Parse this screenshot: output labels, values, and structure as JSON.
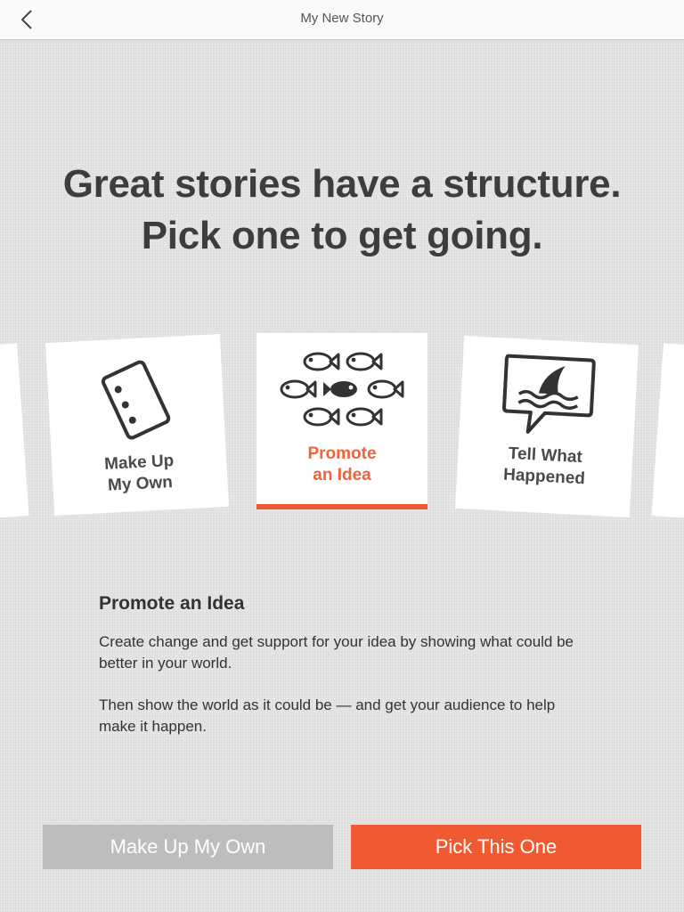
{
  "header": {
    "title": "My New Story",
    "back_icon": "chevron-left-icon"
  },
  "headline": {
    "line1": "Great stories have a structure.",
    "line2": "Pick one to get going."
  },
  "cards": [
    {
      "label_line1": "Make Up",
      "label_line2": "My Own",
      "icon": "notebook-icon",
      "selected": false
    },
    {
      "label_line1": "Promote",
      "label_line2": "an Idea",
      "icon": "fish-school-icon",
      "selected": true
    },
    {
      "label_line1": "Tell What",
      "label_line2": "Happened",
      "icon": "shark-speech-bubble-icon",
      "selected": false
    }
  ],
  "description": {
    "title": "Promote an Idea",
    "paragraph1": "Create change and get support for your idea by showing what could be better in your world.",
    "paragraph2": "Then show the world as it could be — and get your audience to help make it happen."
  },
  "buttons": {
    "secondary_label": "Make Up My Own",
    "primary_label": "Pick This One"
  },
  "colors": {
    "accent": "#f05a32",
    "secondary_button": "#bdbdbd"
  }
}
